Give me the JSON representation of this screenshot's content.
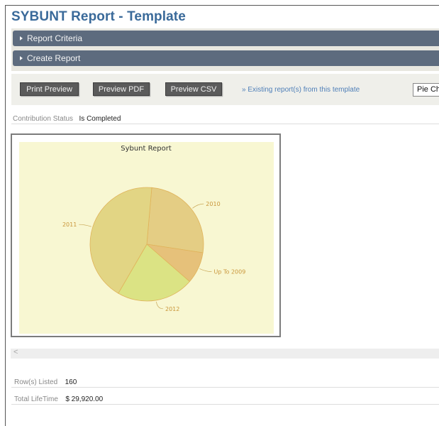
{
  "page": {
    "title": "SYBUNT Report - Template"
  },
  "accordions": [
    {
      "label": "Report Criteria"
    },
    {
      "label": "Create Report"
    }
  ],
  "actions": {
    "print_preview": "Print Preview",
    "preview_pdf": "Preview PDF",
    "preview_csv": "Preview CSV",
    "existing_reports_link": "» Existing report(s) from this template",
    "chart_type_select": "Pie Chart"
  },
  "criteria": {
    "label": "Contribution Status",
    "value": "Is Completed"
  },
  "chart_data": {
    "type": "pie",
    "title": "Sybunt Report",
    "slices": [
      {
        "label": "2010",
        "value": 26,
        "color": "#e4cd84"
      },
      {
        "label": "Up To 2009",
        "value": 9,
        "color": "#e6c17a"
      },
      {
        "label": "2012",
        "value": 22,
        "color": "#dbe384"
      },
      {
        "label": "2011",
        "value": 43,
        "color": "#e2d584"
      }
    ]
  },
  "stats": {
    "rows_listed_label": "Row(s) Listed",
    "rows_listed_value": "160",
    "total_lifetime_label": "Total LifeTime",
    "total_lifetime_value": "$ 29,920.00"
  },
  "scrollbar": {
    "left_arrow": "<"
  }
}
